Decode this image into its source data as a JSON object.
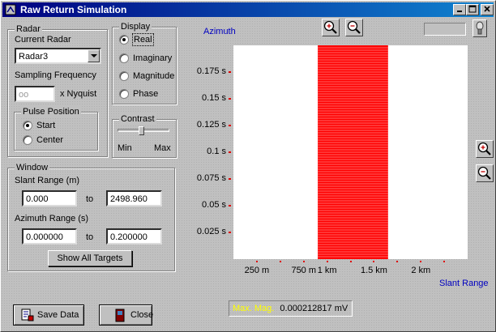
{
  "window": {
    "title": "Raw Return Simulation"
  },
  "radar_group": {
    "label": "Radar",
    "current_radar_label": "Current Radar",
    "current_radar_value": "Radar3",
    "sampling_label": "Sampling Frequency",
    "sampling_value": "oo",
    "sampling_unit": "x Nyquist",
    "pulse_group": {
      "label": "Pulse Position",
      "options": [
        {
          "label": "Start",
          "selected": true
        },
        {
          "label": "Center",
          "selected": false
        }
      ]
    }
  },
  "display_group": {
    "label": "Display",
    "options": [
      {
        "label": "Real",
        "selected": true
      },
      {
        "label": "Imaginary",
        "selected": false
      },
      {
        "label": "Magnitude",
        "selected": false
      },
      {
        "label": "Phase",
        "selected": false
      }
    ]
  },
  "contrast_group": {
    "label": "Contrast",
    "min_label": "Min",
    "max_label": "Max",
    "level": 0.45
  },
  "window_group": {
    "label": "Window",
    "slant_label": "Slant Range  (m)",
    "slant_from": "0.000",
    "slant_to": "2498.960",
    "azimuth_label": "Azimuth Range  (s)",
    "azimuth_from": "0.000000",
    "azimuth_to": "0.200000",
    "to_label": "to",
    "show_all_label": "Show All Targets"
  },
  "buttons": {
    "save_label": "Save Data",
    "close_label": "Close"
  },
  "status": {
    "label": "Max. Mag.",
    "value": "0.000212817 mV",
    "label_color": "#ffff00"
  },
  "chart_data": {
    "type": "heatmap",
    "ylabel": "Azimuth",
    "xlabel": "Slant Range",
    "y_ticks": [
      "0.175 s",
      "0.15 s",
      "0.125 s",
      "0.1 s",
      "0.075 s",
      "0.05 s",
      "0.025 s"
    ],
    "y_tick_values": [
      0.175,
      0.15,
      0.125,
      0.1,
      0.075,
      0.05,
      0.025
    ],
    "x_ticks": [
      "250 m",
      "750 m",
      "1 km",
      "1.5 km",
      "2 km"
    ],
    "x_tick_values": [
      250,
      750,
      1000,
      1500,
      2000
    ],
    "xlim": [
      0,
      2498.96
    ],
    "ylim": [
      0,
      0.2
    ],
    "target_band": {
      "x_start": 900,
      "x_end": 1650,
      "color": "#ff0000",
      "stripes": true
    },
    "grid": false
  }
}
